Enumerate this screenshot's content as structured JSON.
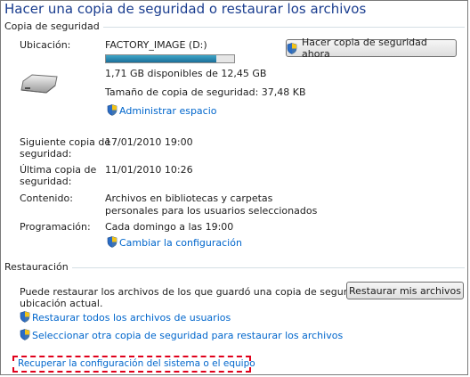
{
  "title": "Hacer una copia de seguridad o restaurar los archivos",
  "backup": {
    "section": "Copia de seguridad",
    "location_label": "Ubicación:",
    "drive_name": "FACTORY_IMAGE (D:)",
    "free_space": "1,71 GB disponibles de 12,45 GB",
    "used_fraction": 0.86,
    "backup_size": "Tamaño de copia de seguridad: 37,48 KB",
    "manage_space": "Administrar espacio",
    "backup_now_button": "Hacer copia de seguridad ahora",
    "next_label_1": "Siguiente copia de",
    "next_label_2": "seguridad:",
    "next_value": "17/01/2010 19:00",
    "last_label_1": "Última copia de",
    "last_label_2": "seguridad:",
    "last_value": "11/01/2010 10:26",
    "contents_label": "Contenido:",
    "contents_value_1": "Archivos en bibliotecas y carpetas",
    "contents_value_2": "personales para los usuarios seleccionados",
    "schedule_label": "Programación:",
    "schedule_value": "Cada domingo a las 19:00",
    "change_settings": "Cambiar la configuración"
  },
  "restore": {
    "section": "Restauración",
    "description_1": "Puede restaurar los archivos de los que guardó una copia de seguridad en la",
    "description_2": "ubicación actual.",
    "restore_my_files_button": "Restaurar mis archivos",
    "restore_all_users": "Restaurar todos los archivos de usuarios",
    "select_other_backup": "Seleccionar otra copia de seguridad para restaurar los archivos",
    "recover_system": "Recuperar la configuración del sistema o el equipo"
  },
  "colors": {
    "title": "#1a3d8f",
    "link": "#0066cc",
    "highlight_border": "#e0001b",
    "progress_fill": "#1c6f99"
  }
}
